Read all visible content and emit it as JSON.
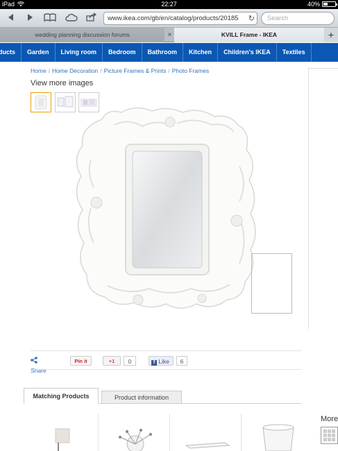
{
  "status_bar": {
    "device": "iPad",
    "time": "22:27",
    "battery": "40%",
    "battery_level": 0.4
  },
  "browser": {
    "url": "www.ikea.com/gb/en/catalog/products/20185",
    "search_placeholder": "Search",
    "tabs": [
      {
        "label": "wedding planning discussion forums",
        "active": false
      },
      {
        "label": "KVILL Frame - IKEA",
        "active": true
      }
    ],
    "close_glyph": "×",
    "new_tab_glyph": "+"
  },
  "nav": {
    "items": [
      "ducts",
      "Garden",
      "Living room",
      "Bedroom",
      "Bathroom",
      "Kitchen",
      "Children's IKEA",
      "Textiles"
    ]
  },
  "breadcrumb": [
    "Home",
    "Home Decoration",
    "Picture Frames & Prints",
    "Photo Frames"
  ],
  "gallery": {
    "view_more": "View more images"
  },
  "social": {
    "share": "Share",
    "pin": "Pin it",
    "gplus": "+1",
    "gplus_count": "0",
    "like": "Like",
    "like_count": "6"
  },
  "product_tabs": {
    "matching": "Matching Products",
    "info": "Product information"
  },
  "matching": {
    "more_label": "More"
  },
  "colors": {
    "ikea_blue": "#0a58b3",
    "link": "#3272b8"
  }
}
